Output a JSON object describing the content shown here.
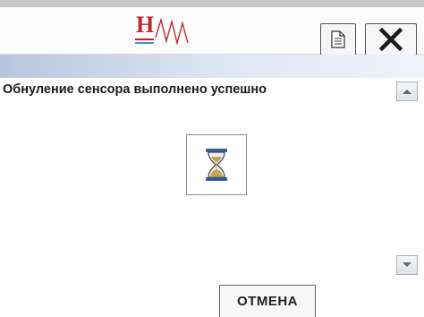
{
  "logo": {
    "letter": "H",
    "text": "HW"
  },
  "message": "Обнуление сенсора выполнено успешно",
  "buttons": {
    "cancel": "ОТМЕНА"
  },
  "icons": {
    "document": "document-icon",
    "close": "close-icon",
    "hourglass": "hourglass-icon",
    "scroll_up": "scroll-up-arrow-icon",
    "scroll_down": "scroll-down-arrow-icon"
  },
  "colors": {
    "logo_red": "#c0262f",
    "banner_blue": "#b7c6df"
  }
}
